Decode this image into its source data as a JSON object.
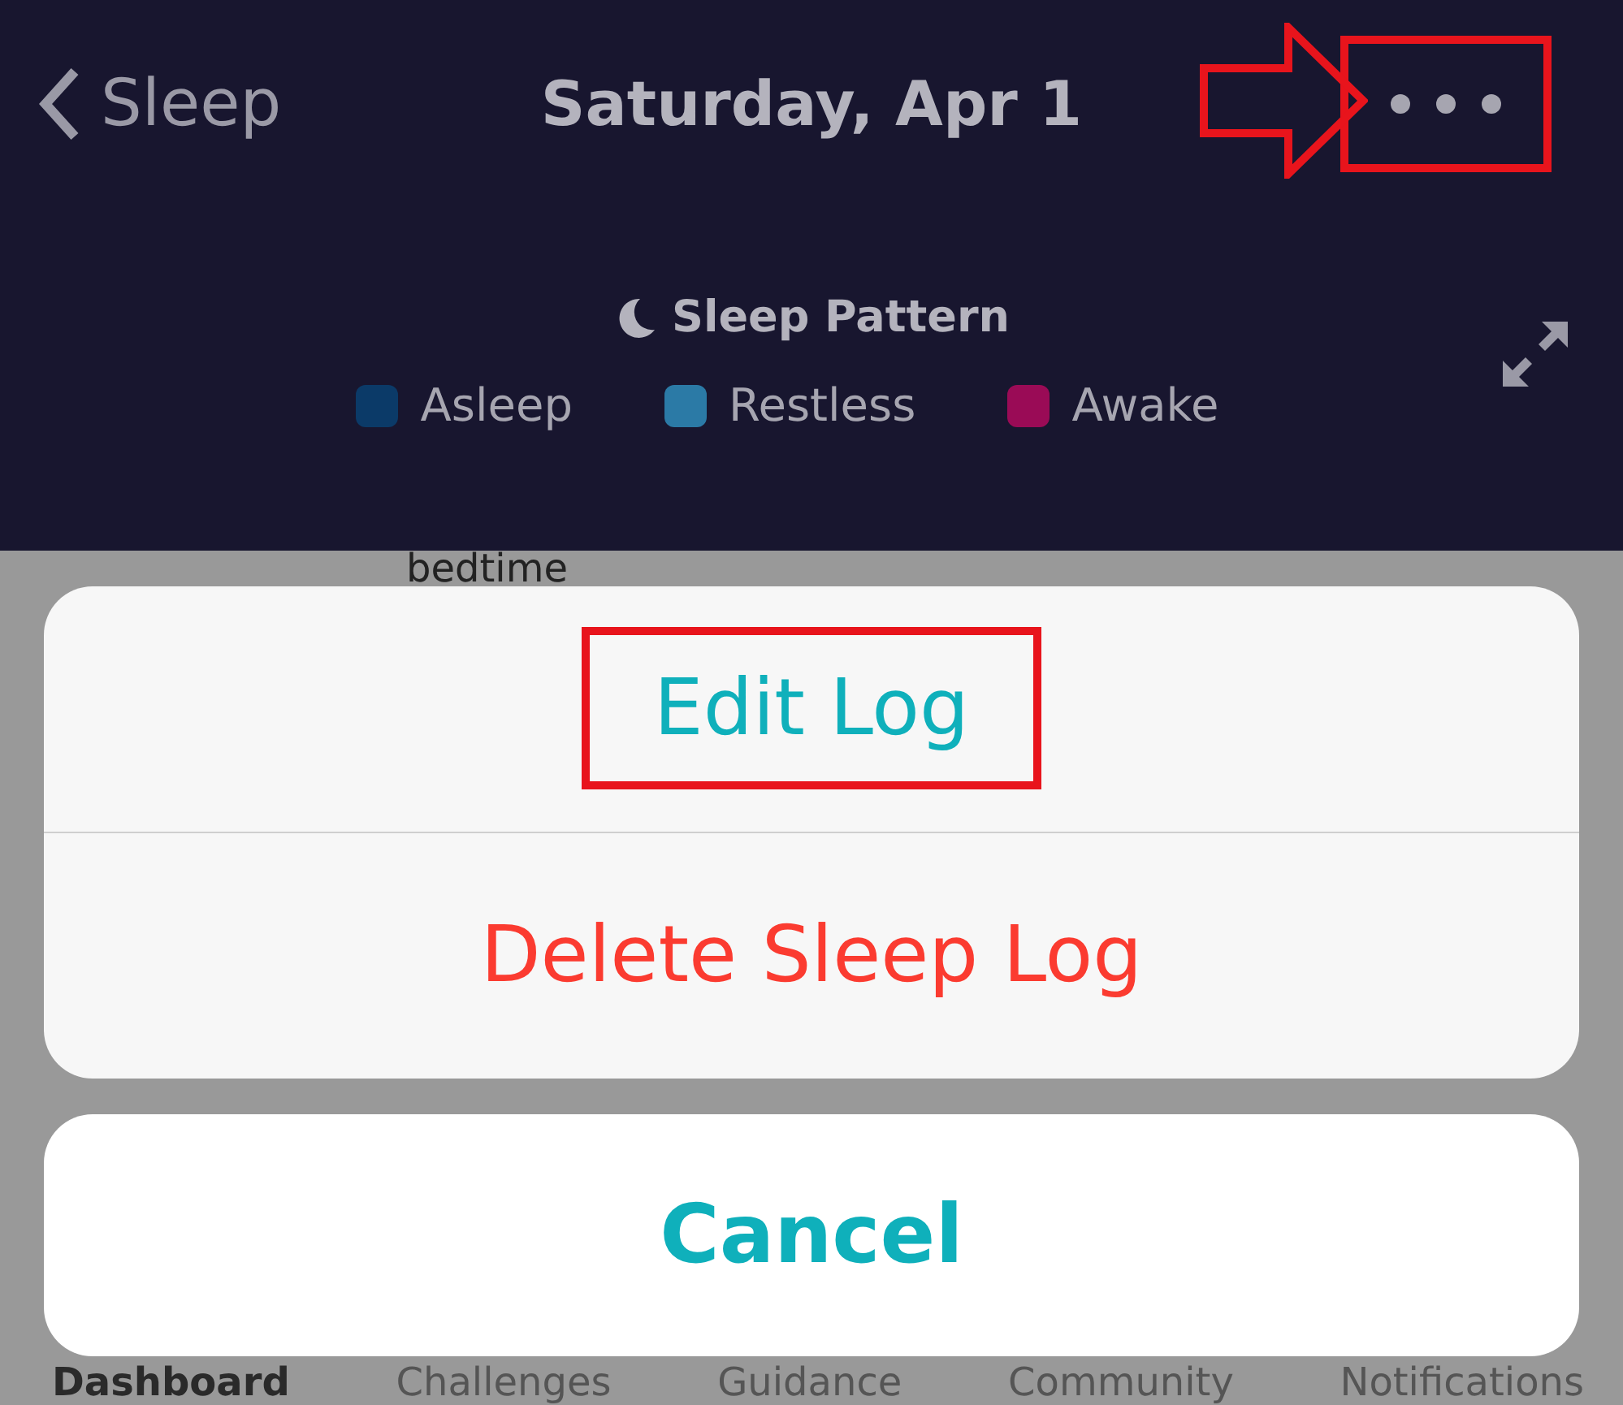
{
  "header": {
    "back_label": "Sleep",
    "title": "Saturday, Apr 1"
  },
  "sleep_pattern": {
    "title": "Sleep Pattern",
    "legend": [
      {
        "label": "Asleep",
        "color": "#0b3a68"
      },
      {
        "label": "Restless",
        "color": "#2b7aa6"
      },
      {
        "label": "Awake",
        "color": "#9a0b56"
      }
    ]
  },
  "background_text": "bedtime",
  "action_sheet": {
    "actions": [
      {
        "label": "Edit Log",
        "kind": "default",
        "highlighted": true
      },
      {
        "label": "Delete Sleep Log",
        "kind": "destructive",
        "highlighted": false
      }
    ],
    "cancel": "Cancel"
  },
  "tab_bar": [
    {
      "label": "Dashboard",
      "selected": true
    },
    {
      "label": "Challenges",
      "selected": false
    },
    {
      "label": "Guidance",
      "selected": false
    },
    {
      "label": "Community",
      "selected": false
    },
    {
      "label": "Notifications",
      "selected": false
    }
  ]
}
